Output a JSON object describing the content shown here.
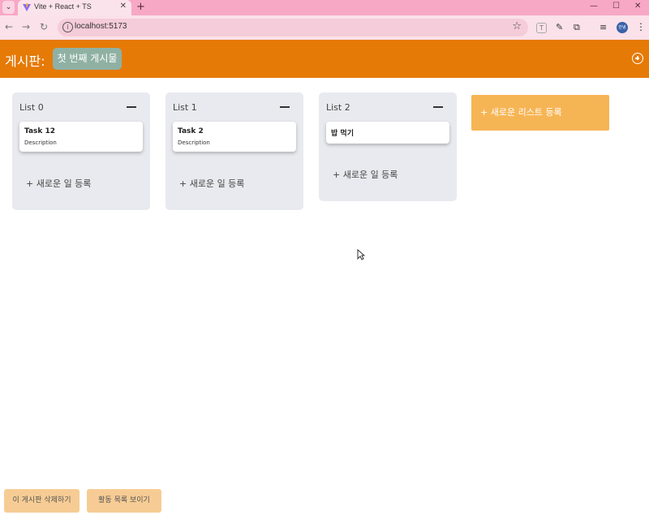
{
  "browser": {
    "tab_title": "Vite + React + TS",
    "url": "localhost:5173",
    "profile_label": "안녕",
    "icons": [
      "tab-menu-icon",
      "vite-favicon-icon",
      "close-icon",
      "new-tab-icon",
      "minimize-icon",
      "maximize-icon",
      "window-close-icon",
      "back-icon",
      "forward-icon",
      "reload-icon",
      "site-info-icon",
      "star-icon",
      "extension-t-icon",
      "pen-icon",
      "puzzle-icon",
      "media-icon",
      "kebab-icon"
    ]
  },
  "header": {
    "board_label": "게시판:",
    "board_name": "첫 번째 게시물",
    "add_board_icon": "plus-circle-icon"
  },
  "lists": [
    {
      "title": "List 0",
      "tasks": [
        {
          "title": "Task 12",
          "description": "Description"
        }
      ],
      "add_label": "+ 새로운 일 등록"
    },
    {
      "title": "List 1",
      "tasks": [
        {
          "title": "Task 2",
          "description": "Description"
        }
      ],
      "add_label": "+ 새로운 일 등록"
    },
    {
      "title": "List 2",
      "tasks": [
        {
          "title": "밥 먹기",
          "description": ""
        }
      ],
      "add_label": "+ 새로운 일 등록"
    }
  ],
  "add_list_label": "+ 새로운 리스트 등록",
  "footer": {
    "delete_board": "이 게시판 삭제하기",
    "show_activity": "활동 목록 보이기"
  },
  "colors": {
    "header_bg": "#e67a06",
    "board_chip": "#8fb1a4",
    "list_bg": "#e9eaef",
    "add_list_bg": "#f6b555",
    "footer_button_bg": "#f7cc94",
    "tabstrip_bg": "#f7a8c4"
  }
}
